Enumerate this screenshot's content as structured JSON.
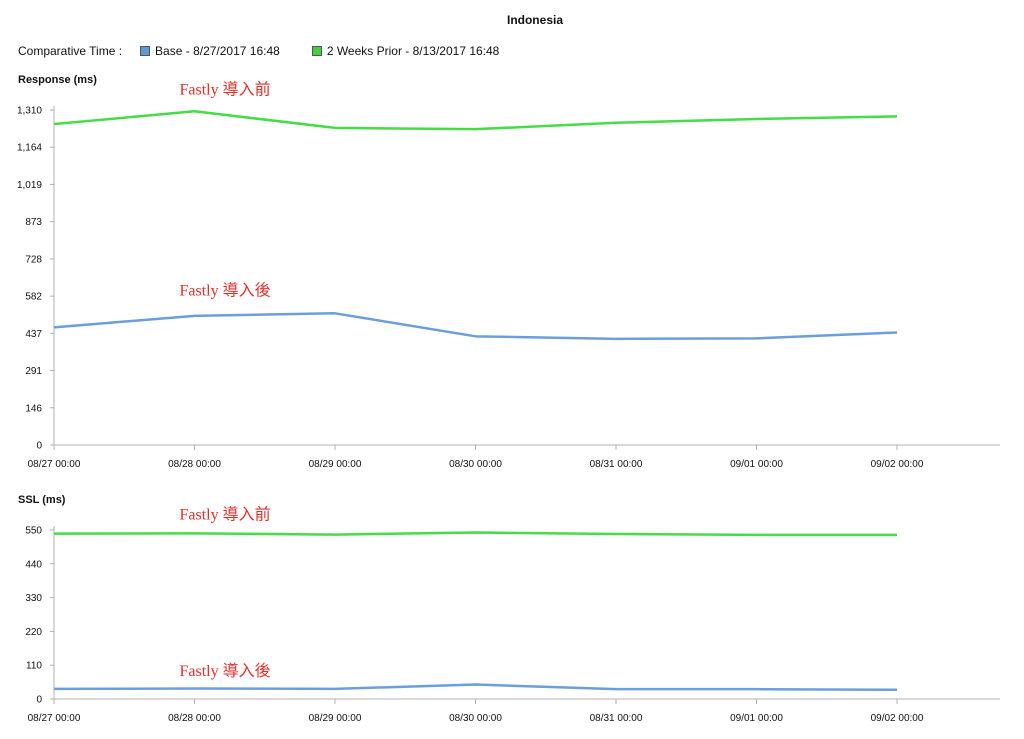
{
  "page": {
    "title": "Indonesia",
    "legend_prefix": "Comparative Time :",
    "legend": [
      {
        "label": "Base - 8/27/2017 16:48",
        "color": "#5b9bd5"
      },
      {
        "label": "2 Weeks Prior - 8/13/2017 16:48",
        "color": "#40d040"
      }
    ]
  },
  "chart_data": [
    {
      "type": "line",
      "title": "Response (ms)",
      "categories": [
        "08/27 00:00",
        "08/28 00:00",
        "08/29 00:00",
        "08/30 00:00",
        "08/31 00:00",
        "09/01 00:00",
        "09/02 00:00"
      ],
      "y_ticks": [
        "0",
        "146",
        "291",
        "437",
        "582",
        "728",
        "873",
        "1,019",
        "1,164",
        "1,310"
      ],
      "ylim": [
        0,
        1310
      ],
      "series": [
        {
          "name": "Base - 8/27/2017 16:48",
          "color": "#6a9fde",
          "values": [
            460,
            505,
            515,
            425,
            415,
            417,
            440
          ]
        },
        {
          "name": "2 Weeks Prior - 8/13/2017 16:48",
          "color": "#44dd44",
          "values": [
            1255,
            1305,
            1240,
            1235,
            1260,
            1275,
            1285
          ]
        }
      ],
      "annotations": [
        {
          "text": "Fastly 導入前",
          "x": "08/28 00:00",
          "y": 1370
        },
        {
          "text": "Fastly 導入後",
          "x": "08/28 00:00",
          "y": 585
        }
      ]
    },
    {
      "type": "line",
      "title": "SSL (ms)",
      "categories": [
        "08/27 00:00",
        "08/28 00:00",
        "08/29 00:00",
        "08/30 00:00",
        "08/31 00:00",
        "09/01 00:00",
        "09/02 00:00"
      ],
      "y_ticks": [
        "0",
        "110",
        "220",
        "330",
        "440",
        "550"
      ],
      "ylim": [
        0,
        550
      ],
      "series": [
        {
          "name": "Base - 8/27/2017 16:48",
          "color": "#6a9fde",
          "values": [
            33,
            34,
            33,
            47,
            32,
            32,
            30
          ]
        },
        {
          "name": "2 Weeks Prior - 8/13/2017 16:48",
          "color": "#44dd44",
          "values": [
            538,
            539,
            535,
            542,
            537,
            534,
            534
          ]
        }
      ],
      "annotations": [
        {
          "text": "Fastly 導入前",
          "x": "08/28 00:00",
          "y": 585
        },
        {
          "text": "Fastly 導入後",
          "x": "08/28 00:00",
          "y": 75
        }
      ]
    }
  ]
}
